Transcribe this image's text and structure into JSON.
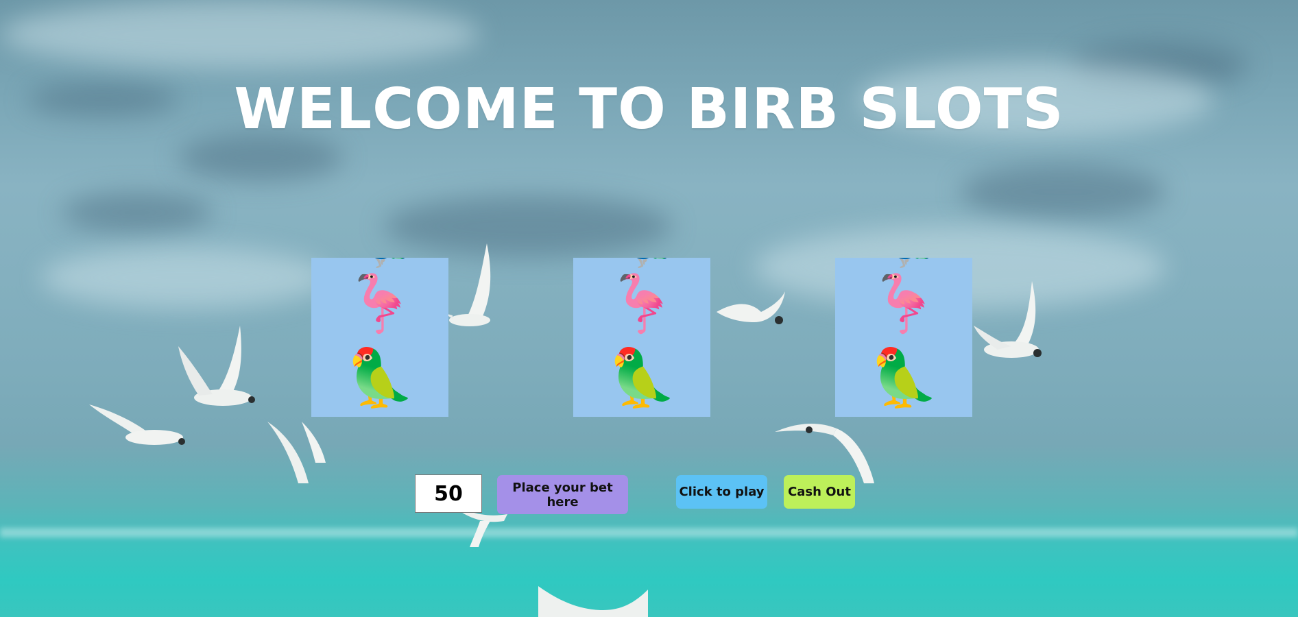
{
  "page": {
    "title": "WELCOME TO BIRB SLOTS"
  },
  "reels": [
    {
      "symbols": [
        {
          "emoji": "🦚",
          "name": "peacock"
        },
        {
          "emoji": "🦩",
          "name": "flamingo"
        },
        {
          "emoji": "🦜",
          "name": "parrot"
        }
      ]
    },
    {
      "symbols": [
        {
          "emoji": "🦚",
          "name": "peacock"
        },
        {
          "emoji": "🦩",
          "name": "flamingo"
        },
        {
          "emoji": "🦜",
          "name": "parrot"
        }
      ]
    },
    {
      "symbols": [
        {
          "emoji": "🦚",
          "name": "peacock"
        },
        {
          "emoji": "🦩",
          "name": "flamingo"
        },
        {
          "emoji": "🦜",
          "name": "parrot"
        }
      ]
    }
  ],
  "controls": {
    "bet_value": "50",
    "bet_button_label": "Place your bet here",
    "play_button_label": "Click to play",
    "cash_out_label": "Cash Out"
  },
  "colors": {
    "reel_background": "#98c6ef",
    "bet_button": "#a490e8",
    "play_button": "#5cc2f5",
    "cash_out_button": "#bdf05a"
  }
}
